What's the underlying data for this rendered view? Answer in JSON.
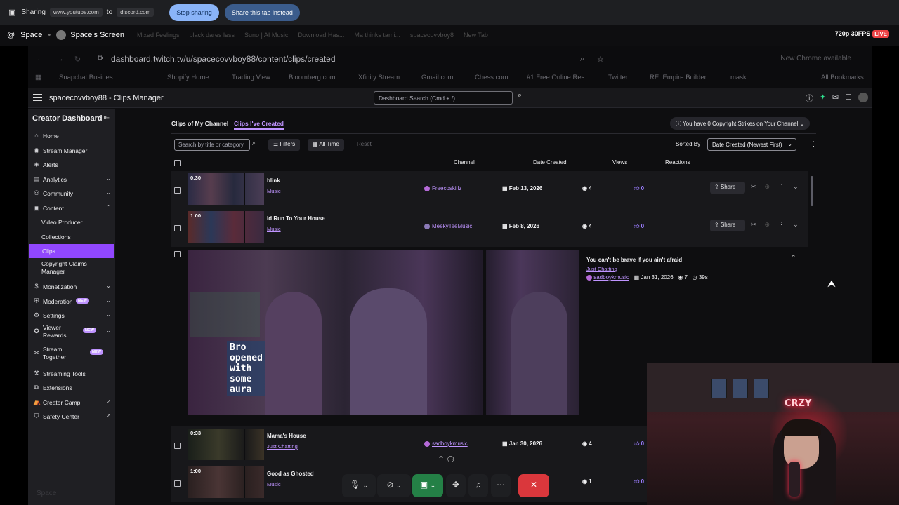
{
  "sharebar": {
    "prefix": "Sharing",
    "from": "www.youtube.com",
    "to_word": "to",
    "to": "discord.com",
    "stop": "Stop sharing",
    "share_tab": "Share this tab instead"
  },
  "discord": {
    "server": "Space",
    "stream_title": "Space's Screen",
    "resolution": "720p 30FPS",
    "live": "LIVE",
    "bottom_label": "Space",
    "ghost_tabs": [
      "Mixed Feelings",
      "black dares less",
      "Suno | AI Music",
      "Download Has...",
      "Ma thinks tami...",
      "spacecovvboy8",
      "New Tab"
    ]
  },
  "browser": {
    "url": "dashboard.twitch.tv/u/spacecovvboy88/content/clips/created",
    "chrome_available": "New Chrome available",
    "bookmarks": [
      {
        "label": "Snapchat Busines..."
      },
      {
        "label": "Shopify Home"
      },
      {
        "label": "Trading View"
      },
      {
        "label": "Bloomberg.com"
      },
      {
        "label": "Xfinity Stream"
      },
      {
        "label": "Gmail.com"
      },
      {
        "label": "Chess.com"
      },
      {
        "label": "#1 Free Online Res..."
      },
      {
        "label": "Twitter"
      },
      {
        "label": "REI Empire Builder..."
      },
      {
        "label": "mask"
      }
    ],
    "all_bookmarks": "All Bookmarks"
  },
  "dashboard": {
    "title": "spacecovvboy88 - Clips Manager",
    "search_placeholder": "Dashboard Search (Cmd + /)"
  },
  "sidebar": {
    "header": "Creator Dashboard",
    "items": [
      {
        "label": "Home",
        "icon": "home-icon"
      },
      {
        "label": "Stream Manager",
        "icon": "stream-manager-icon"
      },
      {
        "label": "Alerts",
        "icon": "alerts-icon"
      },
      {
        "label": "Analytics",
        "icon": "analytics-icon"
      },
      {
        "label": "Community",
        "icon": "community-icon"
      },
      {
        "label": "Content",
        "icon": "content-icon"
      },
      {
        "label": "Video Producer"
      },
      {
        "label": "Collections"
      },
      {
        "label": "Clips"
      },
      {
        "label": "Copyright Claims Manager"
      },
      {
        "label": "Monetization",
        "icon": "monetization-icon"
      },
      {
        "label": "Moderation",
        "icon": "moderation-icon",
        "badge": "NEW"
      },
      {
        "label": "Settings",
        "icon": "settings-icon"
      },
      {
        "label": "Viewer Rewards",
        "icon": "viewer-rewards-icon",
        "badge": "NEW"
      },
      {
        "label": "Stream Together",
        "icon": "stream-together-icon",
        "badge": "NEW"
      },
      {
        "label": "Streaming Tools",
        "icon": "streaming-tools-icon"
      },
      {
        "label": "Extensions",
        "icon": "extensions-icon"
      },
      {
        "label": "Creator Camp",
        "icon": "creator-camp-icon"
      },
      {
        "label": "Safety Center",
        "icon": "safety-center-icon"
      }
    ]
  },
  "clips": {
    "tab_my_channel": "Clips of My Channel",
    "tab_created": "Clips I've Created",
    "copyright": "You have 0 Copyright Strikes on Your Channel",
    "search_placeholder": "Search by title or category",
    "filters": "Filters",
    "all_time": "All Time",
    "reset": "Reset",
    "sorted_by": "Sorted By",
    "sort_value": "Date Created (Newest First)",
    "columns": {
      "channel": "Channel",
      "date": "Date Created",
      "views": "Views",
      "reactions": "Reactions"
    },
    "share": "Share",
    "rows": [
      {
        "duration": "0:30",
        "title": "blink",
        "category": "Music",
        "channel": "Freecoskillz",
        "date": "Feb 13, 2026",
        "views": "4",
        "reactions": "0"
      },
      {
        "duration": "1:00",
        "title": "Id Run To Your House",
        "category": "Music",
        "channel": "MeekyTeeMusic",
        "date": "Feb 8, 2026",
        "views": "4",
        "reactions": "0"
      },
      {
        "duration": "0:33",
        "title": "Mama's House",
        "category": "Just Chatting",
        "channel": "sadboykmusic",
        "date": "Jan 30, 2026",
        "views": "4",
        "reactions": "0"
      },
      {
        "duration": "1:00",
        "title": "Good as Ghosted",
        "category": "Music",
        "channel": "",
        "date": "",
        "views": "1",
        "reactions": "0"
      }
    ],
    "expanded": {
      "title": "You can't be brave if you ain't afraid",
      "category": "Just Chatting",
      "channel": "sadboykmusic",
      "date": "Jan 31, 2026",
      "views": "7",
      "duration": "39s",
      "overlay": "Bro\nopened\nwith\nsome\naura"
    }
  },
  "webcam": {
    "neon_sign": "CRZY"
  }
}
